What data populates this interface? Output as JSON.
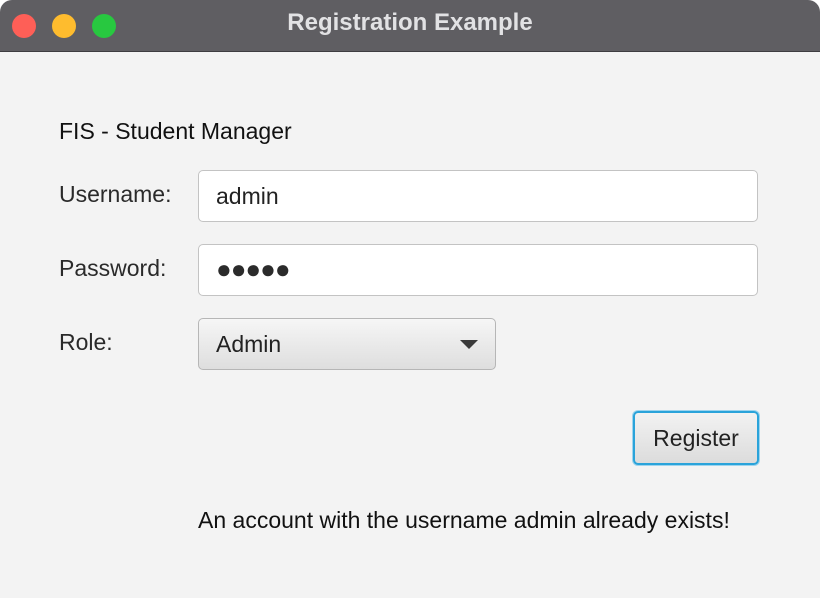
{
  "window": {
    "title": "Registration Example"
  },
  "form": {
    "heading": "FIS - Student Manager",
    "username_label": "Username:",
    "username_value": "admin",
    "password_label": "Password:",
    "password_mask": "●●●●●",
    "role_label": "Role:",
    "role_selected": "Admin",
    "register_label": "Register",
    "message": "An account with the username admin already exists!"
  },
  "colors": {
    "titlebar": "#5f5e62",
    "close": "#fe5f57",
    "minimize": "#febc2e",
    "zoom": "#28c840",
    "focus_ring": "#2aa3da"
  }
}
